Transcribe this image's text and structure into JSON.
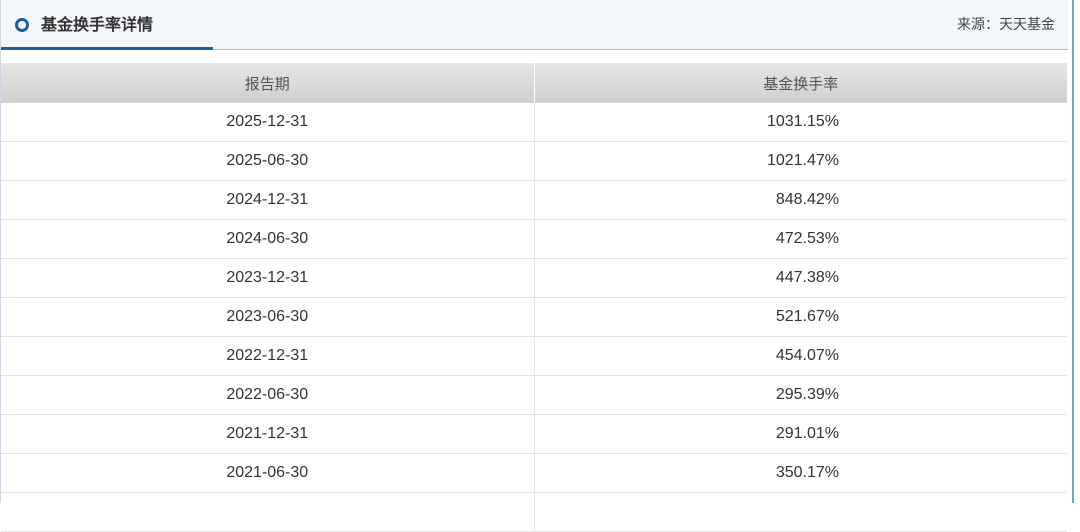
{
  "header": {
    "title": "基金换手率详情",
    "source": "来源：天天基金"
  },
  "table": {
    "columns": [
      "报告期",
      "基金换手率"
    ],
    "rows": [
      {
        "period": "2025-12-31",
        "rate": "1031.15%"
      },
      {
        "period": "2025-06-30",
        "rate": "1021.47%"
      },
      {
        "period": "2024-12-31",
        "rate": "848.42%"
      },
      {
        "period": "2024-06-30",
        "rate": "472.53%"
      },
      {
        "period": "2023-12-31",
        "rate": "447.38%"
      },
      {
        "period": "2023-06-30",
        "rate": "521.67%"
      },
      {
        "period": "2022-12-31",
        "rate": "454.07%"
      },
      {
        "period": "2022-06-30",
        "rate": "295.39%"
      },
      {
        "period": "2021-12-31",
        "rate": "291.01%"
      },
      {
        "period": "2021-06-30",
        "rate": "350.17%"
      }
    ]
  }
}
